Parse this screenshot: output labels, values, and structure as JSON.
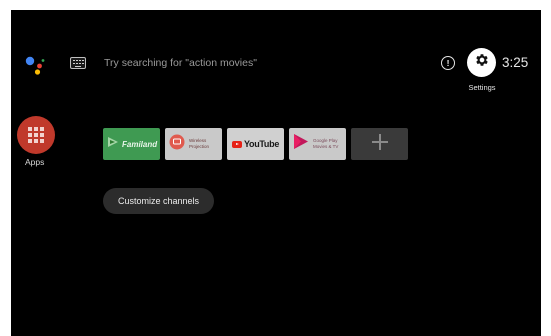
{
  "top_bar": {
    "assistant_icon": "google-assistant-icon",
    "keyboard_icon": "keyboard-icon",
    "search_hint": "Try searching for \"action movies\"",
    "notification_icon": "notification-info-icon",
    "notification_symbol": "!",
    "settings_icon": "gear-icon",
    "settings_label": "Settings",
    "clock": "3:25"
  },
  "apps": {
    "icon": "apps-grid-icon",
    "label": "Apps"
  },
  "channels": [
    {
      "id": "familand",
      "label": "Familand",
      "bg": "#3f9a52"
    },
    {
      "id": "wireless-projection",
      "label_lines": [
        "Wireless",
        "Projection"
      ],
      "bg": "#c9c9c9"
    },
    {
      "id": "youtube",
      "label": "YouTube",
      "bg": "#d0d0d0"
    },
    {
      "id": "google-play-movies",
      "label_lines": [
        "Google Play",
        "Movies & TV"
      ],
      "bg": "#c9c9c9"
    },
    {
      "id": "add-channel",
      "icon": "plus-icon",
      "bg": "#3a3a3a"
    }
  ],
  "customize_channels_label": "Customize channels",
  "colors": {
    "background": "#000000",
    "accent_red": "#c0392b",
    "text_dim": "#9a9a9a"
  }
}
